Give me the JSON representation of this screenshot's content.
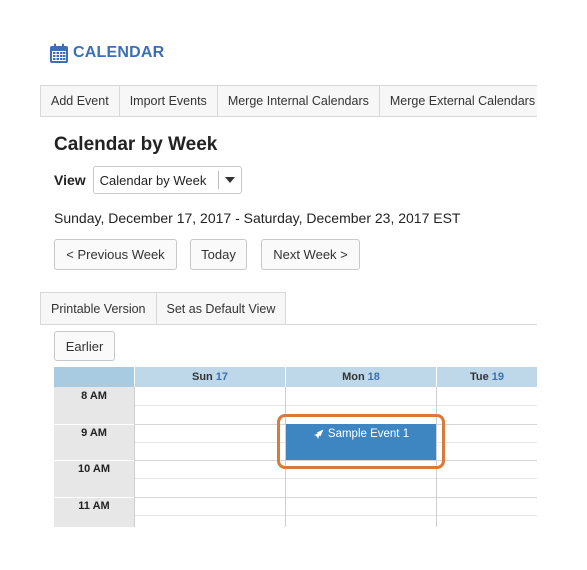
{
  "app": {
    "title": "CALENDAR",
    "icon": "calendar-icon",
    "accent_color": "#3c6fb4"
  },
  "toolbar": {
    "items": [
      "Add Event",
      "Import Events",
      "Merge Internal Calendars",
      "Merge External Calendars"
    ]
  },
  "page": {
    "title": "Calendar by Week",
    "view_label": "View",
    "view_selected": "Calendar by Week",
    "date_range": "Sunday, December 17, 2017 - Saturday, December 23, 2017 EST"
  },
  "nav": {
    "previous": "< Previous Week",
    "today": "Today",
    "next": "Next Week >"
  },
  "subtabs": [
    "Printable Version",
    "Set as Default View"
  ],
  "grid": {
    "earlier_label": "Earlier",
    "days": [
      {
        "name": "Sun",
        "num": "17"
      },
      {
        "name": "Mon",
        "num": "18"
      },
      {
        "name": "Tue",
        "num": "19"
      }
    ],
    "hours": [
      "8 AM",
      "9 AM",
      "10 AM",
      "11 AM"
    ],
    "header_color": "#bed8ea"
  },
  "event": {
    "title": "Sample Event 1",
    "icon": "rocket-icon",
    "color": "#3e86c2",
    "highlight_color": "#d9793a"
  }
}
